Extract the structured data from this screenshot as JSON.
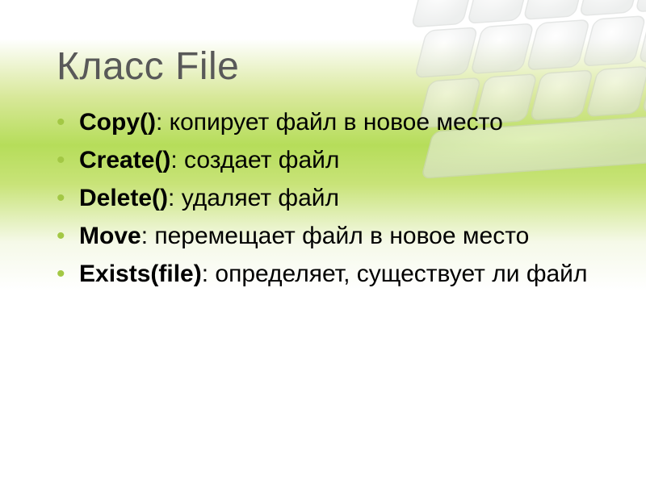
{
  "slide": {
    "title": "Класс File",
    "bullets": [
      {
        "method": "Copy()",
        "desc": ": копирует файл в новое место"
      },
      {
        "method": "Create()",
        "desc": ": создает файл"
      },
      {
        "method": "Delete()",
        "desc": ": удаляет файл"
      },
      {
        "method": "Move",
        "desc": ": перемещает файл в новое место"
      },
      {
        "method": "Exists(file)",
        "desc": ": определяет, существует ли файл"
      }
    ]
  }
}
